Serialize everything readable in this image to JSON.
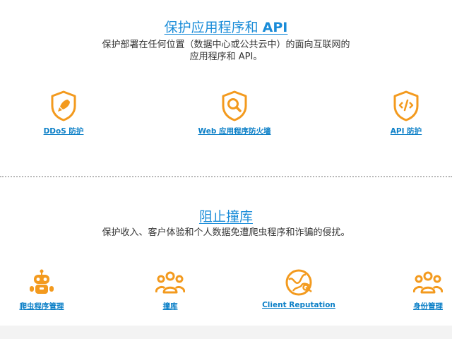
{
  "protect": {
    "title_prefix": "保护应用程序和 ",
    "title_api": "API",
    "subtitle_line1": "保护部署在任何位置（数据中心或公共云中）的面向互联网的",
    "subtitle_line2": "应用程序和 API。",
    "items": [
      {
        "label": "DDoS 防护",
        "icon": "rocket-shield-icon"
      },
      {
        "label": "Web 应用程序防火墙",
        "icon": "magnifier-shield-icon"
      },
      {
        "label": "API 防护",
        "icon": "code-shield-icon"
      }
    ]
  },
  "stuffing": {
    "title": "阻止撞库",
    "subtitle": "保护收入、客户体验和个人数据免遭爬虫程序和诈骗的侵扰。",
    "items": [
      {
        "label": "爬虫程序管理",
        "icon": "robot-icon"
      },
      {
        "label": "撞库",
        "icon": "users-group-icon"
      },
      {
        "label": "Client Reputation",
        "icon": "globe-network-icon"
      },
      {
        "label": "身份管理",
        "icon": "identity-users-icon"
      }
    ]
  },
  "colors": {
    "accent": "#f39a1e",
    "link": "#0b7fc7",
    "title": "#1a8cd8"
  }
}
